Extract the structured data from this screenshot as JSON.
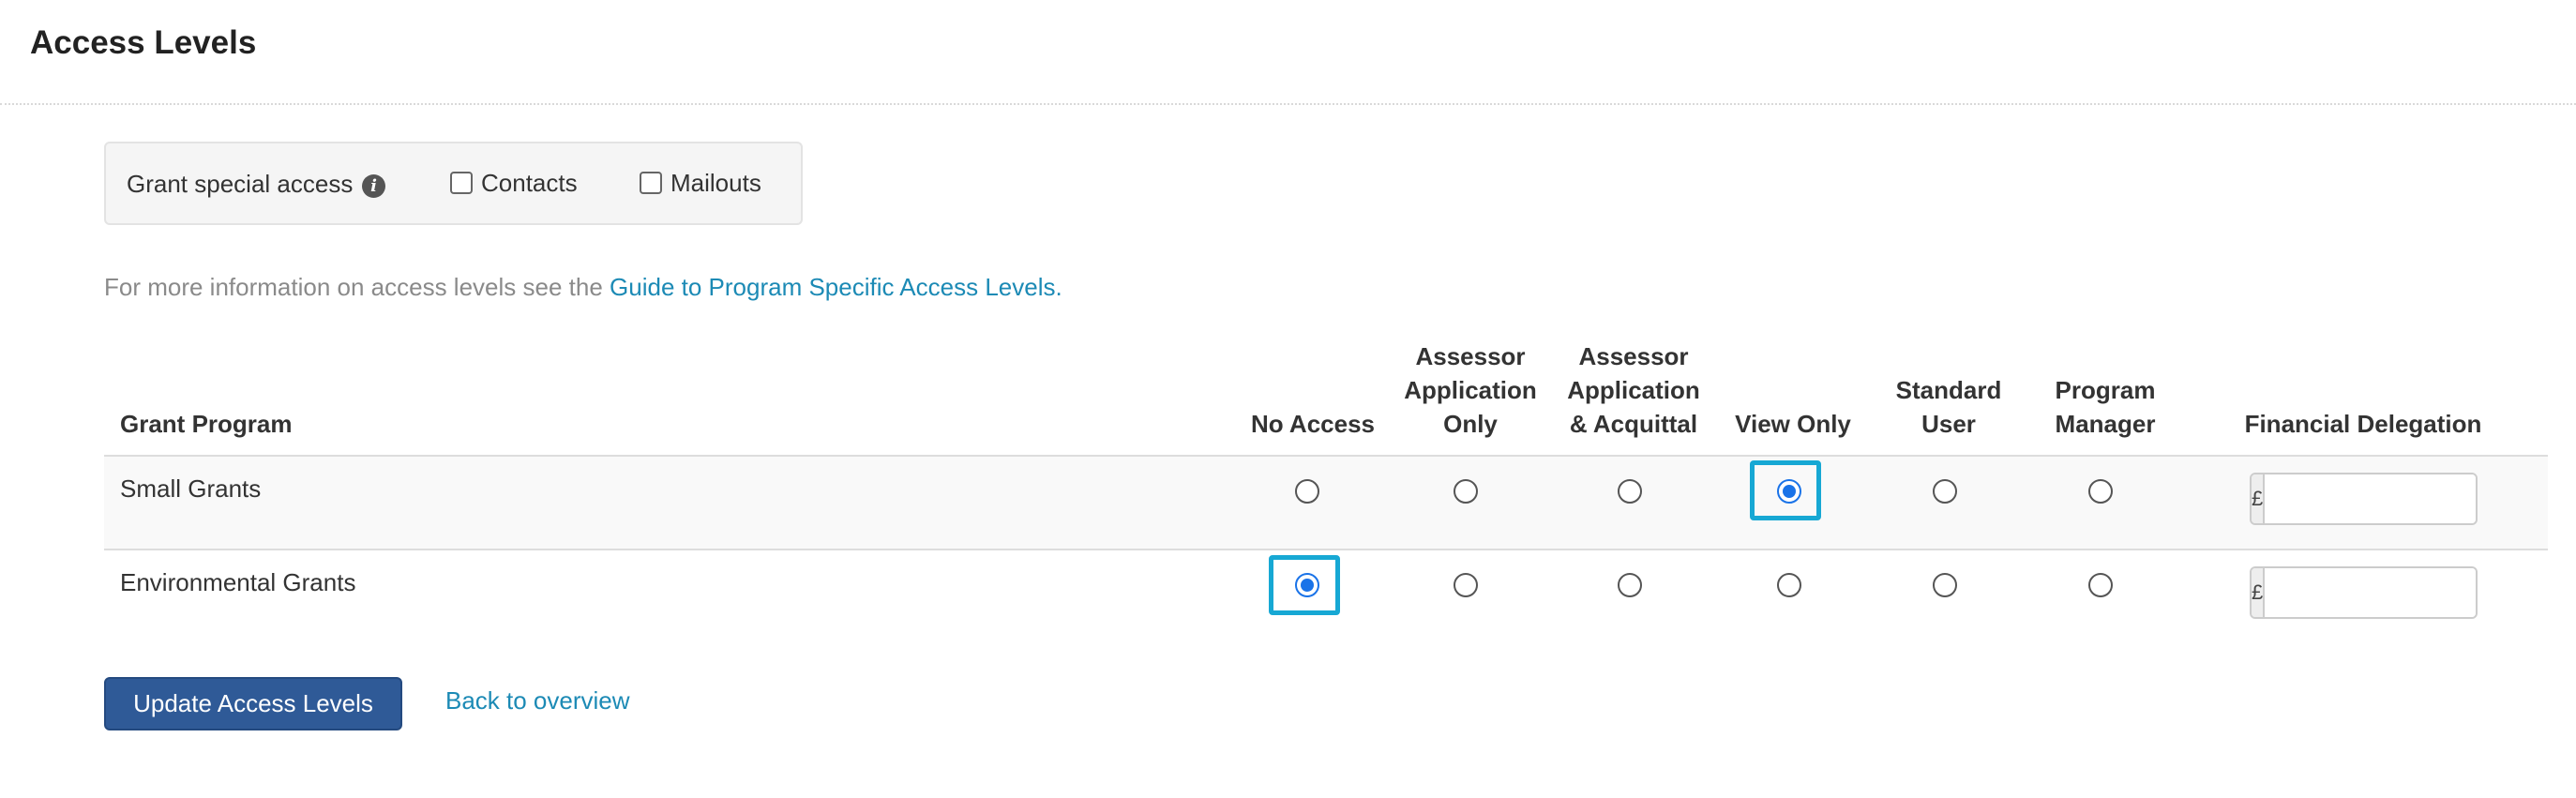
{
  "page": {
    "title": "Access Levels"
  },
  "special_access": {
    "label": "Grant special access",
    "info_icon": "info-icon",
    "options": [
      {
        "label": "Contacts",
        "checked": false
      },
      {
        "label": "Mailouts",
        "checked": false
      }
    ]
  },
  "info": {
    "text": "For more information on access levels see the ",
    "link_text": "Guide to Program Specific Access Levels."
  },
  "table": {
    "headers": {
      "program": "Grant Program",
      "no_access": "No Access",
      "assessor_app_only": [
        "Assessor",
        "Application",
        "Only"
      ],
      "assessor_app_acq": [
        "Assessor",
        "Application",
        "& Acquittal"
      ],
      "view_only": "View Only",
      "standard_user": [
        "Standard",
        "User"
      ],
      "program_manager": [
        "Program",
        "Manager"
      ],
      "financial_delegation": "Financial Delegation"
    },
    "rows": [
      {
        "name": "Small Grants",
        "selected": "View Only",
        "currency": "£",
        "delegation": ""
      },
      {
        "name": "Environmental Grants",
        "selected": "No Access",
        "currency": "£",
        "delegation": ""
      }
    ]
  },
  "actions": {
    "update_label": "Update Access Levels",
    "back_label": "Back to overview"
  },
  "colors": {
    "accent": "#1a73e8",
    "button": "#2f5a97",
    "link": "#1c8ab5",
    "focus": "#17a8d4"
  }
}
